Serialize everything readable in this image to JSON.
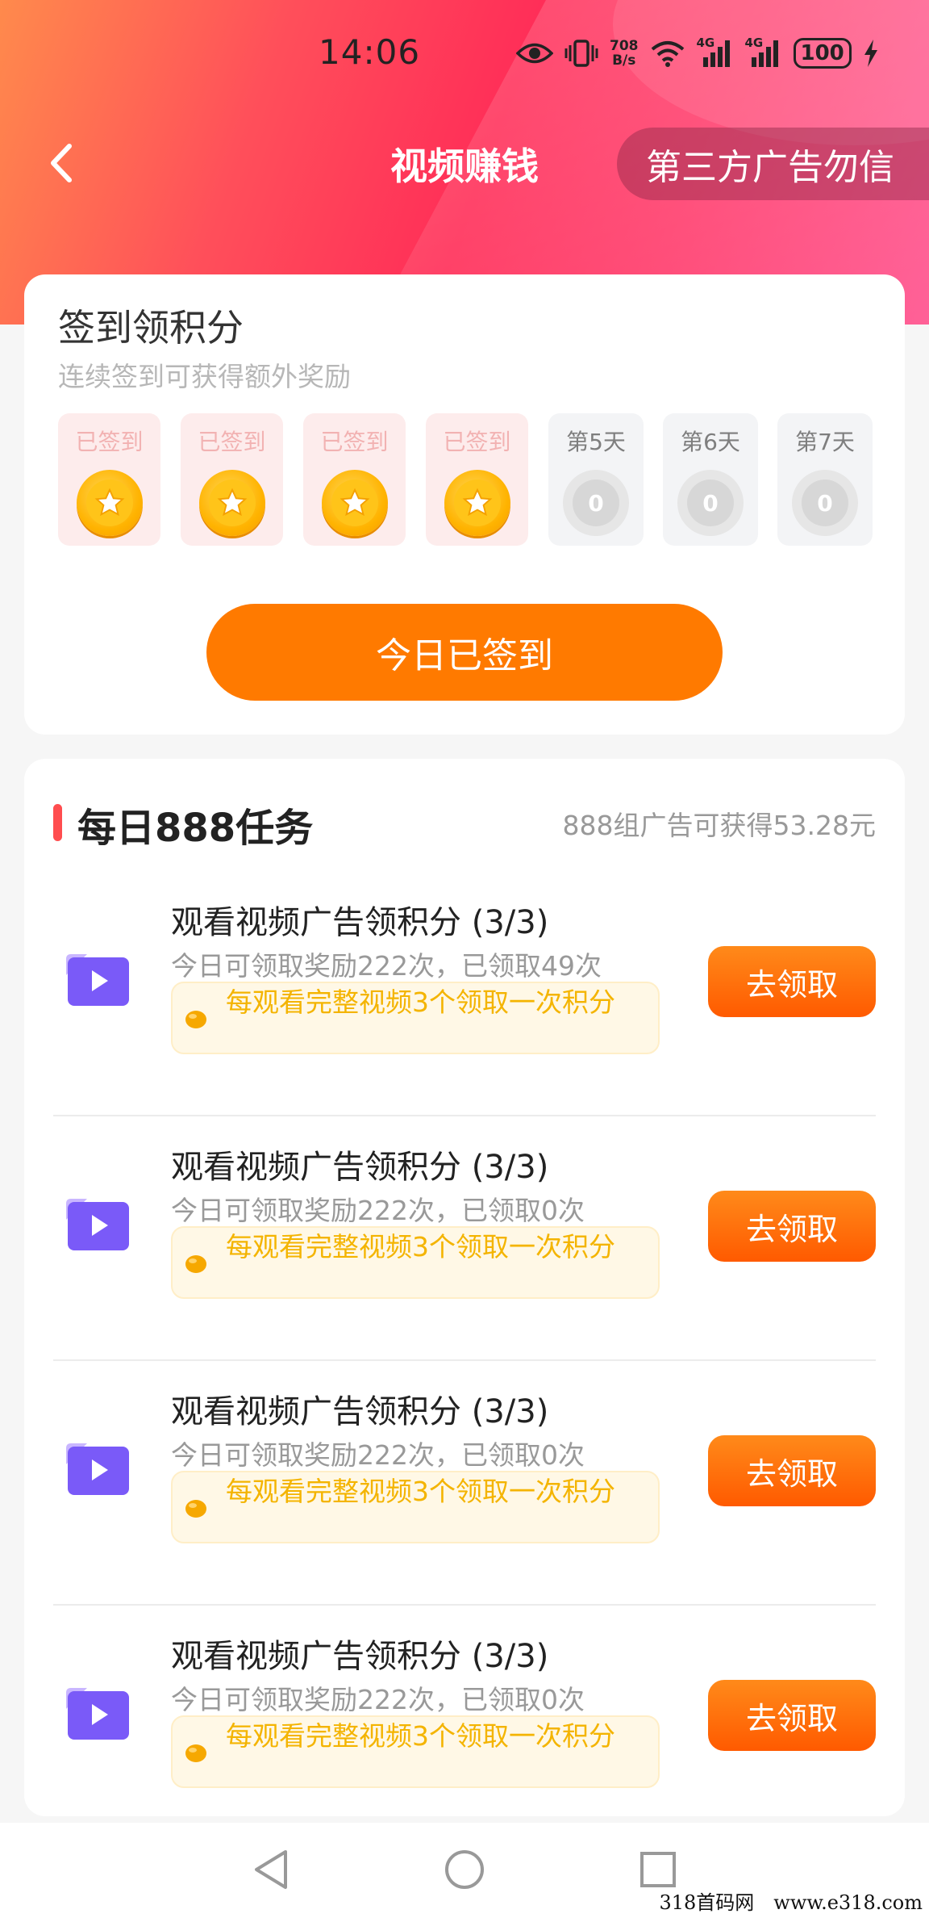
{
  "status_bar": {
    "time": "14:06",
    "net_speed_value": "708",
    "net_speed_unit": "B/s",
    "signal_1_label": "4G",
    "signal_2_label": "4G",
    "battery": "100"
  },
  "header": {
    "title": "视频赚钱",
    "ad_warning": "第三方广告勿信"
  },
  "checkin": {
    "title": "签到领积分",
    "subtitle": "连续签到可获得额外奖励",
    "days": [
      {
        "label": "已签到",
        "state": "signed"
      },
      {
        "label": "已签到",
        "state": "signed"
      },
      {
        "label": "已签到",
        "state": "signed"
      },
      {
        "label": "已签到",
        "state": "signed"
      },
      {
        "label": "第5天",
        "state": "pending",
        "coin_value": "0"
      },
      {
        "label": "第6天",
        "state": "pending",
        "coin_value": "0"
      },
      {
        "label": "第7天",
        "state": "pending",
        "coin_value": "0"
      }
    ],
    "button_label": "今日已签到"
  },
  "tasks": {
    "title": "每日888任务",
    "subtitle": "888组广告可获得53.28元",
    "items": [
      {
        "title": "观看视频广告领积分 (3/3)",
        "desc": "今日可领取奖励222次，已领取49次",
        "tip": "每观看完整视频3个领取一次积分",
        "button": "去领取"
      },
      {
        "title": "观看视频广告领积分 (3/3)",
        "desc": "今日可领取奖励222次，已领取0次",
        "tip": "每观看完整视频3个领取一次积分",
        "button": "去领取"
      },
      {
        "title": "观看视频广告领积分 (3/3)",
        "desc": "今日可领取奖励222次，已领取0次",
        "tip": "每观看完整视频3个领取一次积分",
        "button": "去领取"
      },
      {
        "title": "观看视频广告领积分 (3/3)",
        "desc": "今日可领取奖励222次，已领取0次",
        "tip": "每观看完整视频3个领取一次积分",
        "button": "去领取"
      }
    ]
  },
  "watermark": "318首码网　www.e318.com",
  "colors": {
    "accent_orange": "#ff7a00",
    "hero_pink": "#ff2e58",
    "tip_text": "#f4b400"
  }
}
